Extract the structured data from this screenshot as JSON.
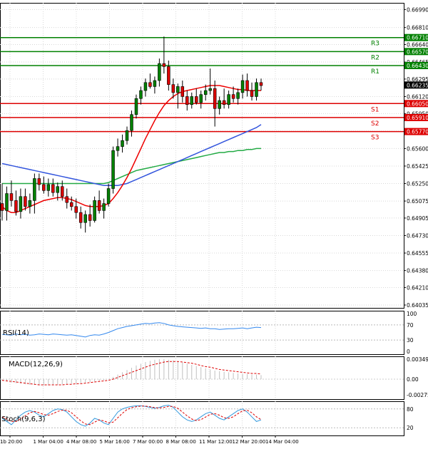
{
  "chart_data": {
    "type": "candlestick",
    "main": {
      "ylim": [
        0.64035,
        0.67
      ],
      "y_ticks": [
        "0.66990",
        "0.66810",
        "0.66640",
        "0.66465",
        "0.66295",
        "0.66120",
        "0.65950",
        "0.65775",
        "0.65600",
        "0.65425",
        "0.65250",
        "0.65075",
        "0.64905",
        "0.64730",
        "0.64555",
        "0.64380",
        "0.64210",
        "0.64035"
      ],
      "current_price": "0.66235",
      "levels": [
        {
          "name": "R3",
          "value": 0.6671,
          "label": "0.66710",
          "color": "#008000"
        },
        {
          "name": "R2",
          "value": 0.6657,
          "label": "0.66570",
          "color": "#008000"
        },
        {
          "name": "R1",
          "value": 0.6643,
          "label": "0.66430",
          "color": "#008000"
        },
        {
          "name": "S1",
          "value": 0.6605,
          "label": "0.66050",
          "color": "#dd0000"
        },
        {
          "name": "S2",
          "value": 0.6591,
          "label": "0.65910",
          "color": "#dd0000"
        },
        {
          "name": "S3",
          "value": 0.6577,
          "label": "0.65770",
          "color": "#dd0000"
        }
      ],
      "candles": [
        {
          "o": 0.6505,
          "h": 0.6525,
          "l": 0.6488,
          "c": 0.6498
        },
        {
          "o": 0.6498,
          "h": 0.6522,
          "l": 0.6488,
          "c": 0.6515
        },
        {
          "o": 0.6515,
          "h": 0.6528,
          "l": 0.6502,
          "c": 0.6508
        },
        {
          "o": 0.6508,
          "h": 0.6518,
          "l": 0.6493,
          "c": 0.6497
        },
        {
          "o": 0.6497,
          "h": 0.652,
          "l": 0.649,
          "c": 0.6512
        },
        {
          "o": 0.6512,
          "h": 0.652,
          "l": 0.6498,
          "c": 0.6502
        },
        {
          "o": 0.6502,
          "h": 0.6515,
          "l": 0.6495,
          "c": 0.6508
        },
        {
          "o": 0.6508,
          "h": 0.6535,
          "l": 0.6495,
          "c": 0.653
        },
        {
          "o": 0.653,
          "h": 0.6535,
          "l": 0.6518,
          "c": 0.6524
        },
        {
          "o": 0.6524,
          "h": 0.6532,
          "l": 0.6515,
          "c": 0.6518
        },
        {
          "o": 0.6518,
          "h": 0.653,
          "l": 0.6512,
          "c": 0.6524
        },
        {
          "o": 0.6524,
          "h": 0.653,
          "l": 0.6512,
          "c": 0.6516
        },
        {
          "o": 0.6516,
          "h": 0.6526,
          "l": 0.6508,
          "c": 0.6522
        },
        {
          "o": 0.6522,
          "h": 0.6528,
          "l": 0.6508,
          "c": 0.6512
        },
        {
          "o": 0.6512,
          "h": 0.652,
          "l": 0.65,
          "c": 0.6506
        },
        {
          "o": 0.6506,
          "h": 0.6512,
          "l": 0.6498,
          "c": 0.6502
        },
        {
          "o": 0.6502,
          "h": 0.651,
          "l": 0.649,
          "c": 0.6496
        },
        {
          "o": 0.6496,
          "h": 0.6502,
          "l": 0.648,
          "c": 0.6486
        },
        {
          "o": 0.6486,
          "h": 0.6498,
          "l": 0.6476,
          "c": 0.6494
        },
        {
          "o": 0.6494,
          "h": 0.6504,
          "l": 0.6482,
          "c": 0.6488
        },
        {
          "o": 0.6488,
          "h": 0.6512,
          "l": 0.6486,
          "c": 0.6508
        },
        {
          "o": 0.6508,
          "h": 0.6518,
          "l": 0.6495,
          "c": 0.6498
        },
        {
          "o": 0.6498,
          "h": 0.651,
          "l": 0.649,
          "c": 0.6505
        },
        {
          "o": 0.6505,
          "h": 0.6525,
          "l": 0.6502,
          "c": 0.652
        },
        {
          "o": 0.652,
          "h": 0.6562,
          "l": 0.6515,
          "c": 0.6558
        },
        {
          "o": 0.6558,
          "h": 0.657,
          "l": 0.6552,
          "c": 0.6562
        },
        {
          "o": 0.6562,
          "h": 0.6574,
          "l": 0.6556,
          "c": 0.6568
        },
        {
          "o": 0.6568,
          "h": 0.6582,
          "l": 0.6564,
          "c": 0.6578
        },
        {
          "o": 0.6578,
          "h": 0.6598,
          "l": 0.6572,
          "c": 0.6594
        },
        {
          "o": 0.6594,
          "h": 0.6614,
          "l": 0.659,
          "c": 0.661
        },
        {
          "o": 0.661,
          "h": 0.6622,
          "l": 0.6604,
          "c": 0.6618
        },
        {
          "o": 0.6618,
          "h": 0.663,
          "l": 0.6612,
          "c": 0.6626
        },
        {
          "o": 0.6626,
          "h": 0.6635,
          "l": 0.662,
          "c": 0.6622
        },
        {
          "o": 0.6622,
          "h": 0.6632,
          "l": 0.6615,
          "c": 0.6628
        },
        {
          "o": 0.6628,
          "h": 0.665,
          "l": 0.6622,
          "c": 0.6645
        },
        {
          "o": 0.6645,
          "h": 0.6672,
          "l": 0.6635,
          "c": 0.6642
        },
        {
          "o": 0.6642,
          "h": 0.6648,
          "l": 0.6618,
          "c": 0.6624
        },
        {
          "o": 0.6624,
          "h": 0.663,
          "l": 0.661,
          "c": 0.6616
        },
        {
          "o": 0.6616,
          "h": 0.6625,
          "l": 0.66,
          "c": 0.6622
        },
        {
          "o": 0.6622,
          "h": 0.6628,
          "l": 0.6606,
          "c": 0.6612
        },
        {
          "o": 0.6612,
          "h": 0.6618,
          "l": 0.6598,
          "c": 0.6604
        },
        {
          "o": 0.6604,
          "h": 0.6616,
          "l": 0.66,
          "c": 0.6612
        },
        {
          "o": 0.6612,
          "h": 0.662,
          "l": 0.6604,
          "c": 0.6606
        },
        {
          "o": 0.6606,
          "h": 0.6618,
          "l": 0.66,
          "c": 0.6614
        },
        {
          "o": 0.6614,
          "h": 0.6624,
          "l": 0.6608,
          "c": 0.6618
        },
        {
          "o": 0.6618,
          "h": 0.664,
          "l": 0.6614,
          "c": 0.662
        },
        {
          "o": 0.662,
          "h": 0.6628,
          "l": 0.6582,
          "c": 0.66
        },
        {
          "o": 0.66,
          "h": 0.6612,
          "l": 0.6594,
          "c": 0.6608
        },
        {
          "o": 0.6608,
          "h": 0.662,
          "l": 0.66,
          "c": 0.6604
        },
        {
          "o": 0.6604,
          "h": 0.6618,
          "l": 0.66,
          "c": 0.6614
        },
        {
          "o": 0.6614,
          "h": 0.6622,
          "l": 0.6606,
          "c": 0.661
        },
        {
          "o": 0.661,
          "h": 0.662,
          "l": 0.6604,
          "c": 0.6616
        },
        {
          "o": 0.6616,
          "h": 0.6634,
          "l": 0.661,
          "c": 0.6628
        },
        {
          "o": 0.6628,
          "h": 0.6635,
          "l": 0.6612,
          "c": 0.6618
        },
        {
          "o": 0.6618,
          "h": 0.6626,
          "l": 0.6608,
          "c": 0.6612
        },
        {
          "o": 0.6612,
          "h": 0.663,
          "l": 0.6608,
          "c": 0.6626
        },
        {
          "o": 0.6626,
          "h": 0.663,
          "l": 0.6618,
          "c": 0.6623
        }
      ],
      "ma_red": [
        0.6502,
        0.6498,
        0.6496,
        0.6496,
        0.6498,
        0.65,
        0.6502,
        0.6504,
        0.6506,
        0.6508,
        0.6509,
        0.651,
        0.6511,
        0.6511,
        0.651,
        0.6509,
        0.6507,
        0.6505,
        0.6503,
        0.6502,
        0.6502,
        0.6502,
        0.6503,
        0.6505,
        0.651,
        0.6516,
        0.6523,
        0.6531,
        0.654,
        0.655,
        0.656,
        0.657,
        0.6579,
        0.6588,
        0.6596,
        0.6603,
        0.6608,
        0.6612,
        0.6615,
        0.6617,
        0.6618,
        0.6619,
        0.662,
        0.6621,
        0.6622,
        0.6623,
        0.6623,
        0.6623,
        0.6622,
        0.6621,
        0.662,
        0.6619,
        0.6619,
        0.6618,
        0.6618,
        0.6618,
        0.6618
      ],
      "ma_blue": [
        0.6545,
        0.6544,
        0.6543,
        0.6542,
        0.6541,
        0.654,
        0.6539,
        0.6538,
        0.6537,
        0.6536,
        0.6535,
        0.6534,
        0.6533,
        0.6532,
        0.6531,
        0.653,
        0.6529,
        0.6528,
        0.6527,
        0.6526,
        0.6525,
        0.6524,
        0.6523,
        0.6523,
        0.6523,
        0.6523,
        0.6524,
        0.6525,
        0.6527,
        0.6529,
        0.6531,
        0.6533,
        0.6535,
        0.6537,
        0.6539,
        0.6541,
        0.6543,
        0.6545,
        0.6547,
        0.6549,
        0.6551,
        0.6553,
        0.6555,
        0.6557,
        0.6559,
        0.6561,
        0.6563,
        0.6565,
        0.6567,
        0.6569,
        0.6571,
        0.6573,
        0.6575,
        0.6577,
        0.6579,
        0.6581,
        0.6584
      ],
      "ma_green": [
        0.6525,
        0.6525,
        0.6525,
        0.6525,
        0.6525,
        0.6525,
        0.6525,
        0.6525,
        0.6525,
        0.6525,
        0.6525,
        0.6525,
        0.6525,
        0.6525,
        0.6525,
        0.6525,
        0.6525,
        0.6525,
        0.6525,
        0.6525,
        0.6525,
        0.6525,
        0.6525,
        0.6526,
        0.6528,
        0.653,
        0.6532,
        0.6534,
        0.6536,
        0.6538,
        0.6539,
        0.654,
        0.6541,
        0.6542,
        0.6543,
        0.6544,
        0.6545,
        0.6546,
        0.6547,
        0.6548,
        0.6549,
        0.655,
        0.6551,
        0.6552,
        0.6553,
        0.6554,
        0.6555,
        0.6556,
        0.6556,
        0.6557,
        0.6557,
        0.6558,
        0.6558,
        0.6559,
        0.6559,
        0.656,
        0.656
      ]
    },
    "rsi": {
      "label": "RSI(14)",
      "ylim": [
        0,
        100
      ],
      "y_ticks": [
        "100",
        "70",
        "30",
        "0"
      ],
      "values": [
        45,
        44,
        43,
        46,
        44,
        45,
        43,
        44,
        46,
        45,
        44,
        46,
        45,
        44,
        43,
        44,
        42,
        40,
        38,
        42,
        44,
        43,
        46,
        50,
        55,
        60,
        63,
        66,
        68,
        70,
        72,
        74,
        73,
        75,
        76,
        74,
        70,
        68,
        66,
        65,
        64,
        63,
        62,
        61,
        62,
        60,
        60,
        58,
        59,
        60,
        60,
        61,
        62,
        60,
        62,
        64,
        63
      ]
    },
    "macd": {
      "label": "MACD(12,26,9)",
      "ylim": [
        -0.002752,
        0.003498
      ],
      "y_ticks": [
        "0.003498",
        "0.00",
        "-0.002752"
      ],
      "values": [
        -0.0003,
        -0.0004,
        -0.0006,
        -0.0007,
        -0.0008,
        -0.0009,
        -0.001,
        -0.001,
        -0.0011,
        -0.0011,
        -0.0011,
        -0.001,
        -0.001,
        -0.0009,
        -0.0009,
        -0.0008,
        -0.0008,
        -0.0007,
        -0.0006,
        -0.0005,
        -0.0004,
        -0.0003,
        -0.0002,
        0.0,
        0.0004,
        0.0008,
        0.0012,
        0.0016,
        0.002,
        0.0024,
        0.0027,
        0.003,
        0.0032,
        0.0034,
        0.0035,
        0.0035,
        0.0034,
        0.0033,
        0.0031,
        0.0029,
        0.0027,
        0.0025,
        0.0023,
        0.0021,
        0.0019,
        0.0017,
        0.0015,
        0.0014,
        0.0013,
        0.0012,
        0.0011,
        0.001,
        0.0009,
        0.0009,
        0.0008,
        0.0008,
        0.0007
      ],
      "signal": [
        -0.0002,
        -0.0003,
        -0.0004,
        -0.0005,
        -0.0006,
        -0.0007,
        -0.0008,
        -0.0009,
        -0.001,
        -0.001,
        -0.001,
        -0.001,
        -0.001,
        -0.001,
        -0.0009,
        -0.0009,
        -0.0008,
        -0.0008,
        -0.0007,
        -0.0006,
        -0.0005,
        -0.0004,
        -0.0003,
        -0.0002,
        0.0,
        0.0003,
        0.0006,
        0.0009,
        0.0012,
        0.0015,
        0.0018,
        0.0021,
        0.0024,
        0.0026,
        0.0028,
        0.003,
        0.0031,
        0.0031,
        0.0031,
        0.003,
        0.0029,
        0.0028,
        0.0026,
        0.0024,
        0.0022,
        0.0021,
        0.0019,
        0.0017,
        0.0016,
        0.0015,
        0.0014,
        0.0013,
        0.0012,
        0.0011,
        0.001,
        0.001,
        0.0009
      ]
    },
    "stoch": {
      "label": "Stoch(9,6,3)",
      "ylim": [
        0,
        100
      ],
      "y_ticks": [
        "80",
        "20"
      ],
      "k": [
        50,
        40,
        30,
        45,
        60,
        70,
        75,
        70,
        60,
        55,
        65,
        75,
        80,
        78,
        70,
        55,
        40,
        30,
        25,
        35,
        50,
        45,
        35,
        30,
        50,
        70,
        80,
        85,
        88,
        90,
        90,
        88,
        85,
        82,
        85,
        90,
        92,
        85,
        70,
        55,
        45,
        40,
        45,
        55,
        65,
        70,
        60,
        50,
        45,
        55,
        65,
        75,
        80,
        70,
        55,
        40,
        45
      ],
      "d": [
        55,
        48,
        40,
        40,
        48,
        58,
        68,
        72,
        68,
        62,
        60,
        65,
        72,
        76,
        76,
        68,
        55,
        42,
        32,
        30,
        38,
        45,
        42,
        36,
        38,
        52,
        66,
        78,
        84,
        87,
        89,
        89,
        87,
        84,
        83,
        85,
        88,
        88,
        82,
        70,
        58,
        48,
        43,
        46,
        54,
        63,
        65,
        60,
        52,
        50,
        55,
        65,
        74,
        76,
        68,
        55,
        46
      ]
    },
    "x_ticks": [
      "1b 20:00",
      "1 Mar 04:00",
      "4 Mar 08:00",
      "5 Mar 16:00",
      "7 Mar 00:00",
      "8 Mar 08:00",
      "11 Mar 12:00",
      "12 Mar 20:00",
      "14 Mar 04:00"
    ],
    "colors": {
      "bull": "#008000",
      "bear": "#dd0000",
      "wick": "#000000",
      "ma_red": "#ee0000",
      "ma_blue": "#3355dd",
      "ma_green": "#22aa44",
      "rsi_line": "#3388ee",
      "macd_hist": "#dd0000",
      "macd_signal": "#dd0000",
      "stoch_k": "#3399dd",
      "stoch_d": "#dd0000"
    }
  }
}
